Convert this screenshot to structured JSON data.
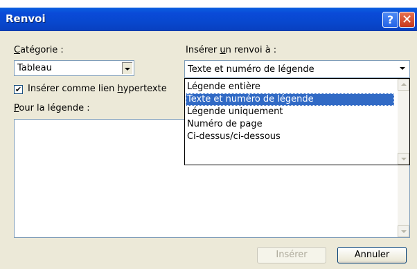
{
  "window": {
    "title": "Renvoi",
    "help_glyph": "?",
    "close_glyph": "✕"
  },
  "category": {
    "label_prefix": "",
    "label_accel": "C",
    "label_rest": "atégorie :",
    "value": "Tableau"
  },
  "insert_ref": {
    "label_pre": "Insérer ",
    "label_accel": "u",
    "label_post": "n renvoi à :",
    "value": "Texte et numéro de légende",
    "options": [
      "Légende entière",
      "Texte et numéro de légende",
      "Légende uniquement",
      "Numéro de page",
      "Ci-dessus/ci-dessous"
    ],
    "selected_index": 1
  },
  "hyperlink": {
    "checked": true,
    "check_glyph": "✔",
    "label_pre": "Insérer comme lien ",
    "label_accel": "h",
    "label_post": "ypertexte"
  },
  "for_caption": {
    "label_accel": "P",
    "label_rest": "our la légende :"
  },
  "buttons": {
    "insert": "Insérer",
    "insert_enabled": false,
    "cancel": "Annuler"
  }
}
